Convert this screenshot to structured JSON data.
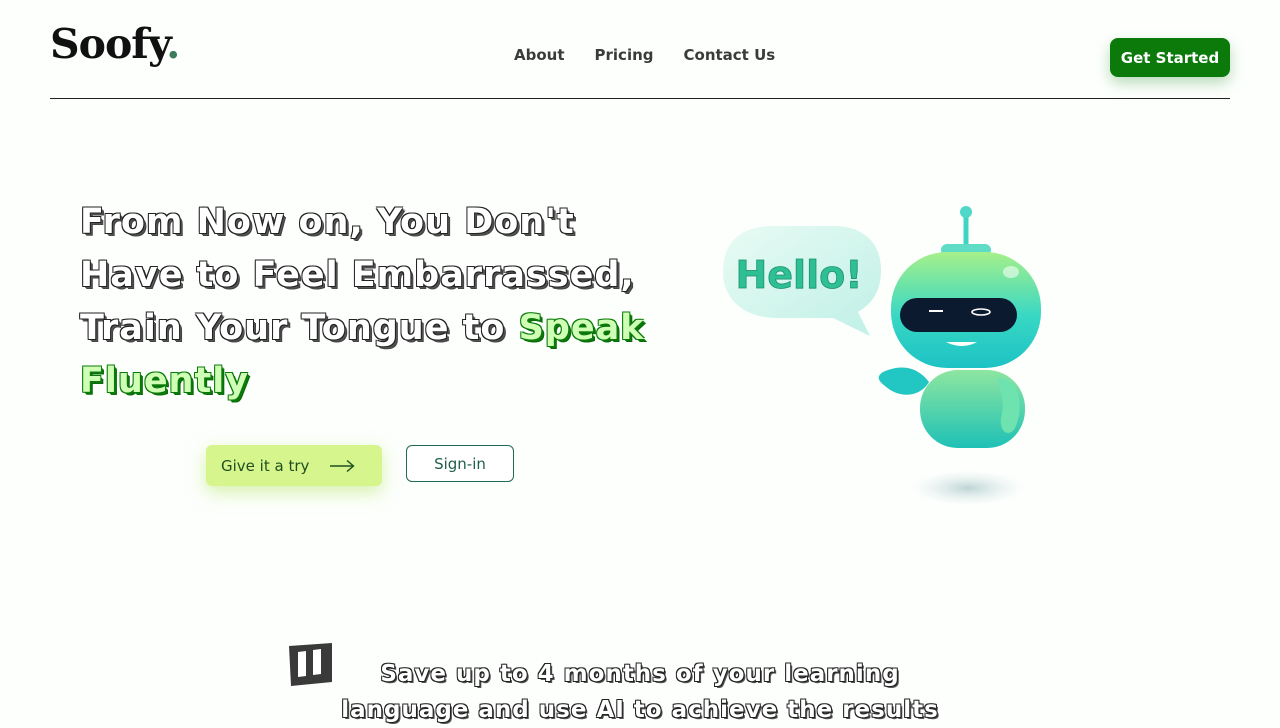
{
  "brand": {
    "name": "Soofy",
    "dot": "."
  },
  "nav": {
    "links": [
      {
        "label": "About"
      },
      {
        "label": "Pricing"
      },
      {
        "label": "Contact Us"
      }
    ],
    "cta_label": "Get Started"
  },
  "hero": {
    "headline_lines": [
      "From Now on, You Don't",
      "Have to Feel Embarrassed,",
      "Train Your Tongue to "
    ],
    "headline_highlight_1": "Speak",
    "headline_highlight_2": "Fluently",
    "try_label": "Give it a try",
    "signin_label": "Sign-in",
    "bubble_text": "Hello!"
  },
  "testimonial": {
    "line_1": "Save up to 4 months of your learning",
    "line_2": "language and use AI to achieve the results"
  },
  "colors": {
    "brand_green": "#0b7a0b",
    "highlight_green": "#cfffb4",
    "try_button_bg": "#d6f58d",
    "robot_teal": "#2fd1c5"
  },
  "icons": [
    "arrow-right-icon",
    "quote-icon",
    "robot-illustration"
  ]
}
